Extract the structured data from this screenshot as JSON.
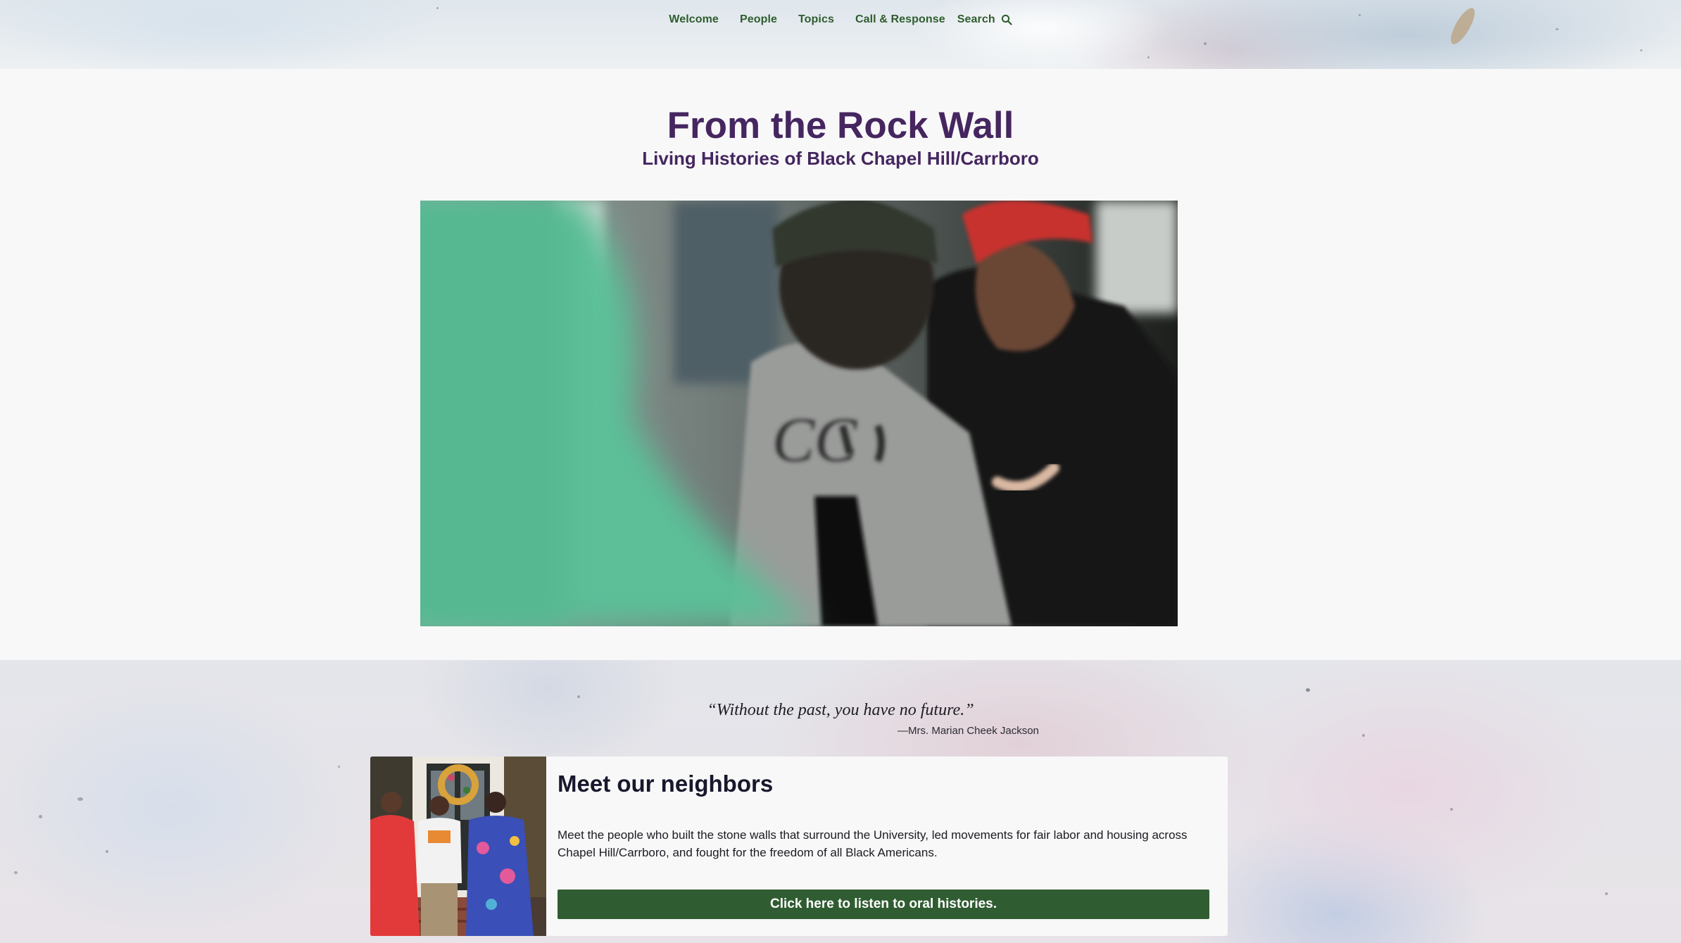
{
  "nav": {
    "items": [
      {
        "label": "Welcome"
      },
      {
        "label": "People"
      },
      {
        "label": "Topics"
      },
      {
        "label": "Call & Response"
      }
    ],
    "search_label": "Search",
    "search_icon": "search-icon"
  },
  "hero": {
    "title": "From the Rock Wall",
    "subtitle": "Living Histories of Black Chapel Hill/Carrboro"
  },
  "quote": {
    "text": "“Without the past, you have no future.”",
    "attribution": "—Mrs. Marian Cheek Jackson"
  },
  "card": {
    "title": "Meet our neighbors",
    "text": "Meet the people who built the stone walls that surround the University, led movements for fair labor and housing across Chapel Hill/Carrboro, and fought for the freedom of all Black Americans.",
    "button_label": "Click here to listen to oral histories."
  },
  "colors": {
    "nav_text": "#2f5d2e",
    "title": "#45265f",
    "button_bg": "#305c32",
    "page_bg": "#f8f8f8"
  }
}
